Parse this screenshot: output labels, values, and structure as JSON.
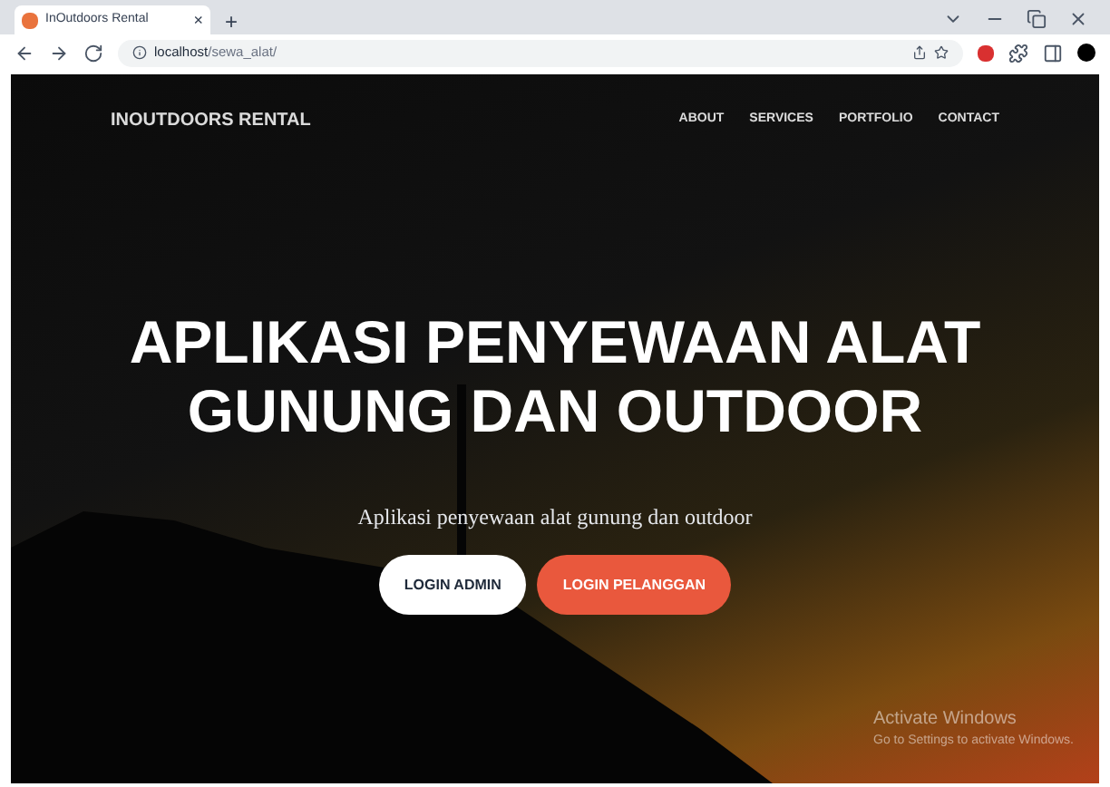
{
  "browser": {
    "tab_title": "InOutdoors Rental",
    "tab_close": "×",
    "new_tab": "+",
    "url_host": "localhost",
    "url_path": "/sewa_alat/"
  },
  "navbar": {
    "brand": "INOUTDOORS RENTAL",
    "links": [
      "ABOUT",
      "SERVICES",
      "PORTFOLIO",
      "CONTACT"
    ]
  },
  "hero": {
    "title_lines": [
      "APLIKASI PENYEWAAN ALAT",
      "GUNUNG DAN OUTDOOR"
    ],
    "subtitle": "Aplikasi penyewaan alat gunung dan outdoor",
    "buttons": [
      {
        "label": "LOGIN ADMIN",
        "kind": "light"
      },
      {
        "label": "LOGIN PELANGGAN",
        "kind": "accent"
      }
    ]
  },
  "os_notice": {
    "title": "Activate Windows",
    "text": "Go to Settings to activate Windows."
  }
}
